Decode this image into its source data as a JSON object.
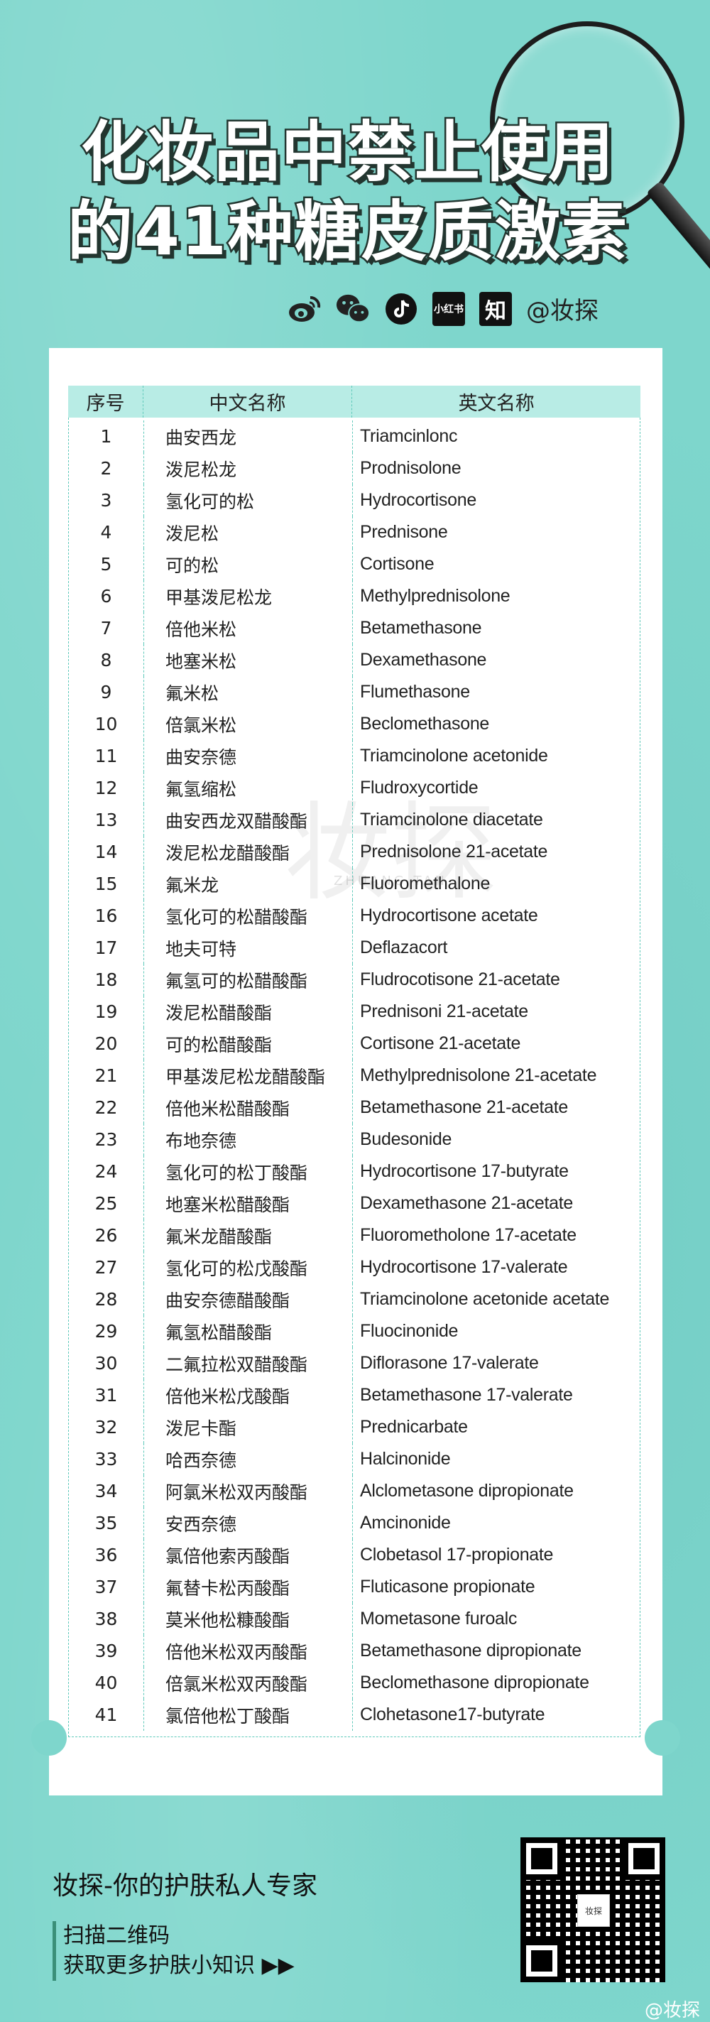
{
  "header": {
    "title_line1": "化妆品中禁止使用",
    "title_line2": "的41种糖皮质激素"
  },
  "social": {
    "icons": [
      "weibo-icon",
      "wechat-icon",
      "tiktok-icon",
      "xiaohongshu-icon",
      "zhihu-icon"
    ],
    "xiaohongshu_label": "小红书",
    "zhihu_label": "知",
    "handle": "@妆探"
  },
  "table": {
    "headers": [
      "序号",
      "中文名称",
      "英文名称"
    ],
    "rows": [
      [
        "1",
        "曲安西龙",
        "Triamcinlonc"
      ],
      [
        "2",
        "泼尼松龙",
        "Prodnisolone"
      ],
      [
        "3",
        "氢化可的松",
        "Hydrocortisone"
      ],
      [
        "4",
        "泼尼松",
        "Prednisone"
      ],
      [
        "5",
        "可的松",
        "Cortisone"
      ],
      [
        "6",
        "甲基泼尼松龙",
        "Methylprednisolone"
      ],
      [
        "7",
        "倍他米松",
        "Betamethasone"
      ],
      [
        "8",
        "地塞米松",
        "Dexamethasone"
      ],
      [
        "9",
        "氟米松",
        "Flumethasone"
      ],
      [
        "10",
        "倍氯米松",
        "Beclomethasone"
      ],
      [
        "11",
        "曲安奈德",
        "Triamcinolone acetonide"
      ],
      [
        "12",
        "氟氢缩松",
        "Fludroxycortide"
      ],
      [
        "13",
        "曲安西龙双醋酸酯",
        "Triamcinolone diacetate"
      ],
      [
        "14",
        "泼尼松龙醋酸酯",
        "Prednisolone 21-acetate"
      ],
      [
        "15",
        "氟米龙",
        "Fluoromethalone"
      ],
      [
        "16",
        "氢化可的松醋酸酯",
        "Hydrocortisone acetate"
      ],
      [
        "17",
        "地夫可特",
        "Deflazacort"
      ],
      [
        "18",
        "氟氢可的松醋酸酯",
        "Fludrocotisone 21-acetate"
      ],
      [
        "19",
        "泼尼松醋酸酯",
        "Prednisoni 21-acetate"
      ],
      [
        "20",
        "可的松醋酸酯",
        "Cortisone 21-acetate"
      ],
      [
        "21",
        "甲基泼尼松龙醋酸酯",
        "Methylprednisolone 21-acetate"
      ],
      [
        "22",
        "倍他米松醋酸酯",
        "Betamethasone 21-acetate"
      ],
      [
        "23",
        "布地奈德",
        "Budesonide"
      ],
      [
        "24",
        "氢化可的松丁酸酯",
        "Hydrocortisone 17-butyrate"
      ],
      [
        "25",
        "地塞米松醋酸酯",
        "Dexamethasone 21-acetate"
      ],
      [
        "26",
        "氟米龙醋酸酯",
        "Fluorometholone 17-acetate"
      ],
      [
        "27",
        "氢化可的松戊酸酯",
        "Hydrocortisone 17-valerate"
      ],
      [
        "28",
        "曲安奈德醋酸酯",
        "Triamcinolone acetonide acetate"
      ],
      [
        "29",
        "氟氢松醋酸酯",
        "Fluocinonide"
      ],
      [
        "30",
        "二氟拉松双醋酸酯",
        "Diflorasone 17-valerate"
      ],
      [
        "31",
        "倍他米松戊酸酯",
        "Betamethasone 17-valerate"
      ],
      [
        "32",
        "泼尼卡酯",
        "Prednicarbate"
      ],
      [
        "33",
        "哈西奈德",
        "Halcinonide"
      ],
      [
        "34",
        "阿氯米松双丙酸酯",
        "Alclometasone dipropionate"
      ],
      [
        "35",
        "安西奈德",
        "Amcinonide"
      ],
      [
        "36",
        "氯倍他索丙酸酯",
        "Clobetasol 17-propionate"
      ],
      [
        "37",
        "氟替卡松丙酸酯",
        "Fluticasone propionate"
      ],
      [
        "38",
        "莫米他松糠酸酯",
        "Mometasone furoalc"
      ],
      [
        "39",
        "倍他米松双丙酸酯",
        "Betamethasone dipropionate"
      ],
      [
        "40",
        "倍氯米松双丙酸酯",
        "Beclomethasone dipropionate"
      ],
      [
        "41",
        "氯倍他松丁酸酯",
        "Clohetasone17-butyrate"
      ]
    ]
  },
  "watermark": {
    "text": "妆探",
    "subtitle": "ZHUANG TAN"
  },
  "footer": {
    "slogan": "妆探-你的护肤私人专家",
    "cta_line1": "扫描二维码",
    "cta_line2": "获取更多护肤小知识 ▶▶",
    "qr_logo": "妆探",
    "weibo_watermark": "@妆探"
  },
  "colors": {
    "background": "#7ed6cc",
    "header_row": "#b8ece5",
    "divider": "#5fc9ba"
  }
}
